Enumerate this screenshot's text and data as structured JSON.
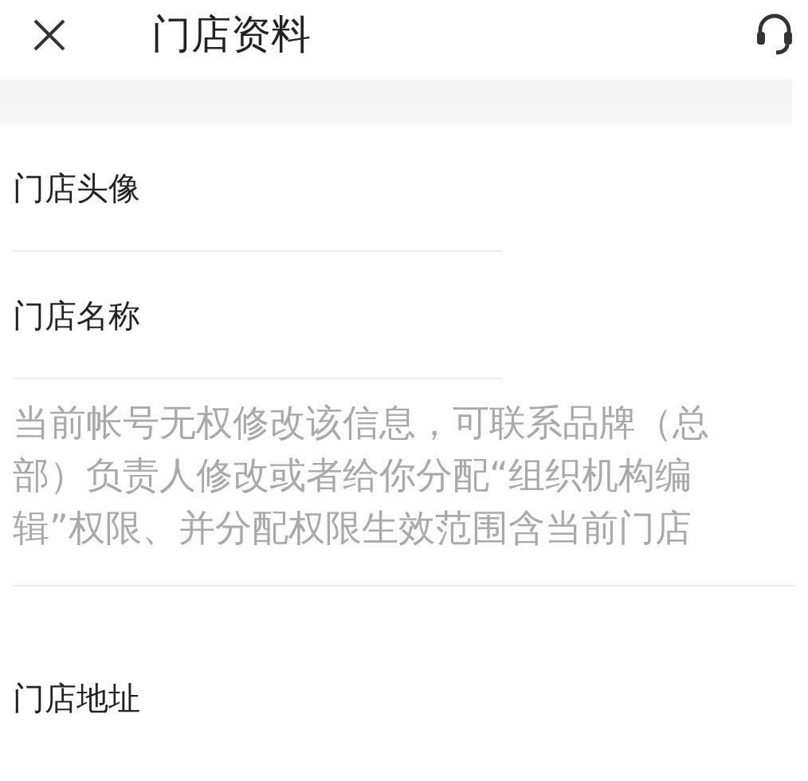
{
  "header": {
    "title": "门店资料"
  },
  "items": [
    {
      "kind": "field",
      "label": "门店头像"
    },
    {
      "kind": "field",
      "label": "门店名称"
    },
    {
      "kind": "notice",
      "label": "当前帐号无权修改该信息，可联系品牌（总部）负责人修改或者给你分配“组织机构编辑”权限、并分配权限生效范围含当前门店"
    },
    {
      "kind": "field",
      "label": "门店地址"
    }
  ]
}
